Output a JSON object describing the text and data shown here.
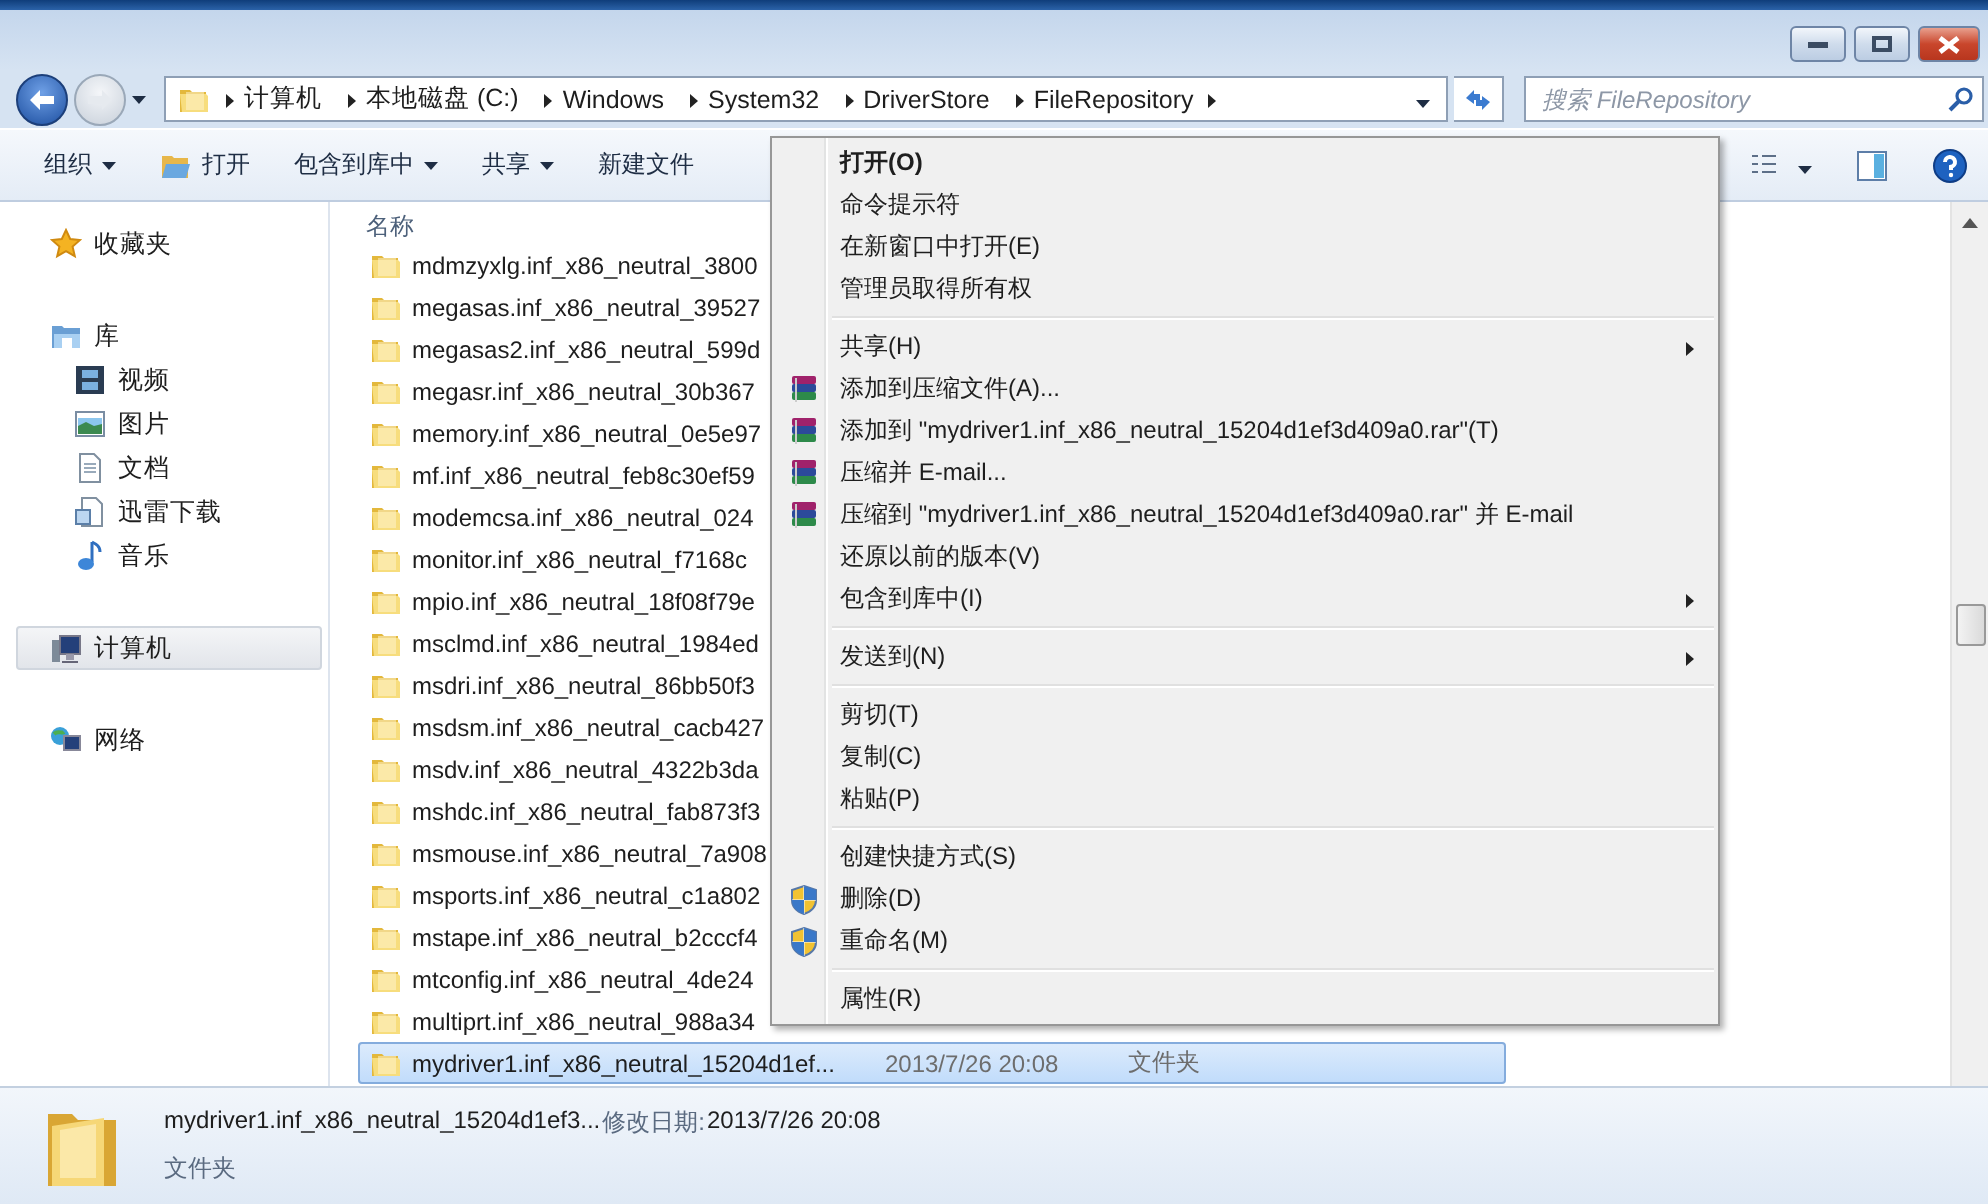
{
  "address_bar": {
    "crumbs": [
      "计算机",
      "本地磁盘 (C:)",
      "Windows",
      "System32",
      "DriverStore",
      "FileRepository"
    ]
  },
  "search": {
    "placeholder": "搜索 FileRepository"
  },
  "toolbar": {
    "buttons": [
      {
        "label": "组织",
        "kind": "dropdown"
      },
      {
        "label": "打开",
        "kind": "icon"
      },
      {
        "label": "包含到库中",
        "kind": "dropdown"
      },
      {
        "label": "共享",
        "kind": "dropdown"
      },
      {
        "label": "新建文件",
        "kind": "plain"
      }
    ]
  },
  "sidebar": {
    "items": [
      {
        "label": "收藏夹",
        "selected": false
      },
      {
        "label": "库",
        "selected": false,
        "children": [
          {
            "label": "视频",
            "selected": false
          },
          {
            "label": "图片",
            "selected": false
          },
          {
            "label": "文档",
            "selected": false
          },
          {
            "label": "迅雷下载",
            "selected": false
          },
          {
            "label": "音乐",
            "selected": false
          }
        ]
      },
      {
        "label": "计算机",
        "selected": true
      },
      {
        "label": "网络",
        "selected": false
      }
    ]
  },
  "file_list": {
    "column_header": "名称",
    "rows": [
      {
        "name": "mdmzyxlg.inf_x86_neutral_3800",
        "selected": false
      },
      {
        "name": "megasas.inf_x86_neutral_39527",
        "selected": false
      },
      {
        "name": "megasas2.inf_x86_neutral_599d",
        "selected": false
      },
      {
        "name": "megasr.inf_x86_neutral_30b367",
        "selected": false
      },
      {
        "name": "memory.inf_x86_neutral_0e5e97",
        "selected": false
      },
      {
        "name": "mf.inf_x86_neutral_feb8c30ef59",
        "selected": false
      },
      {
        "name": "modemcsa.inf_x86_neutral_024",
        "selected": false
      },
      {
        "name": "monitor.inf_x86_neutral_f7168c",
        "selected": false
      },
      {
        "name": "mpio.inf_x86_neutral_18f08f79e",
        "selected": false
      },
      {
        "name": "msclmd.inf_x86_neutral_1984ed",
        "selected": false
      },
      {
        "name": "msdri.inf_x86_neutral_86bb50f3",
        "selected": false
      },
      {
        "name": "msdsm.inf_x86_neutral_cacb427",
        "selected": false
      },
      {
        "name": "msdv.inf_x86_neutral_4322b3da",
        "selected": false
      },
      {
        "name": "mshdc.inf_x86_neutral_fab873f3",
        "selected": false
      },
      {
        "name": "msmouse.inf_x86_neutral_7a908",
        "selected": false
      },
      {
        "name": "msports.inf_x86_neutral_c1a802",
        "selected": false
      },
      {
        "name": "mstape.inf_x86_neutral_b2cccf4",
        "selected": false
      },
      {
        "name": "mtconfig.inf_x86_neutral_4de24",
        "selected": false
      },
      {
        "name": "multiprt.inf_x86_neutral_988a34",
        "selected": false
      },
      {
        "name": "mydriver1.inf_x86_neutral_15204d1ef...",
        "selected": true,
        "date": "2013/7/26 20:08",
        "type": "文件夹"
      }
    ]
  },
  "context_menu": {
    "groups": [
      {
        "items": [
          {
            "label": "打开(O)",
            "default": true,
            "submenu": false
          },
          {
            "label": "命令提示符",
            "default": false,
            "submenu": false
          },
          {
            "label": "在新窗口中打开(E)",
            "default": false,
            "submenu": false
          },
          {
            "label": "管理员取得所有权",
            "default": false,
            "submenu": false
          }
        ]
      },
      {
        "items": [
          {
            "label": "共享(H)",
            "default": false,
            "submenu": true
          },
          {
            "label": "添加到压缩文件(A)...",
            "kind": "archive",
            "default": false,
            "submenu": false
          },
          {
            "label": "添加到 \"mydriver1.inf_x86_neutral_15204d1ef3d409a0.rar\"(T)",
            "kind": "archive",
            "default": false,
            "submenu": false
          },
          {
            "label": "压缩并 E-mail...",
            "kind": "archive",
            "default": false,
            "submenu": false
          },
          {
            "label": "压缩到 \"mydriver1.inf_x86_neutral_15204d1ef3d409a0.rar\" 并 E-mail",
            "kind": "archive",
            "default": false,
            "submenu": false
          },
          {
            "label": "还原以前的版本(V)",
            "default": false,
            "submenu": false
          },
          {
            "label": "包含到库中(I)",
            "default": false,
            "submenu": true
          }
        ]
      },
      {
        "items": [
          {
            "label": "发送到(N)",
            "default": false,
            "submenu": true
          }
        ]
      },
      {
        "items": [
          {
            "label": "剪切(T)",
            "default": false,
            "submenu": false
          },
          {
            "label": "复制(C)",
            "default": false,
            "submenu": false
          },
          {
            "label": "粘贴(P)",
            "default": false,
            "submenu": false
          }
        ]
      },
      {
        "items": [
          {
            "label": "创建快捷方式(S)",
            "default": false,
            "submenu": false
          },
          {
            "label": "删除(D)",
            "kind": "shield",
            "default": false,
            "submenu": false
          },
          {
            "label": "重命名(M)",
            "kind": "shield",
            "default": false,
            "submenu": false
          }
        ]
      },
      {
        "items": [
          {
            "label": "属性(R)",
            "default": false,
            "submenu": false
          }
        ]
      }
    ]
  },
  "details_pane": {
    "name": "mydriver1.inf_x86_neutral_15204d1ef3...",
    "modified_label": "修改日期:",
    "modified": "2013/7/26 20:08",
    "type": "文件夹"
  }
}
